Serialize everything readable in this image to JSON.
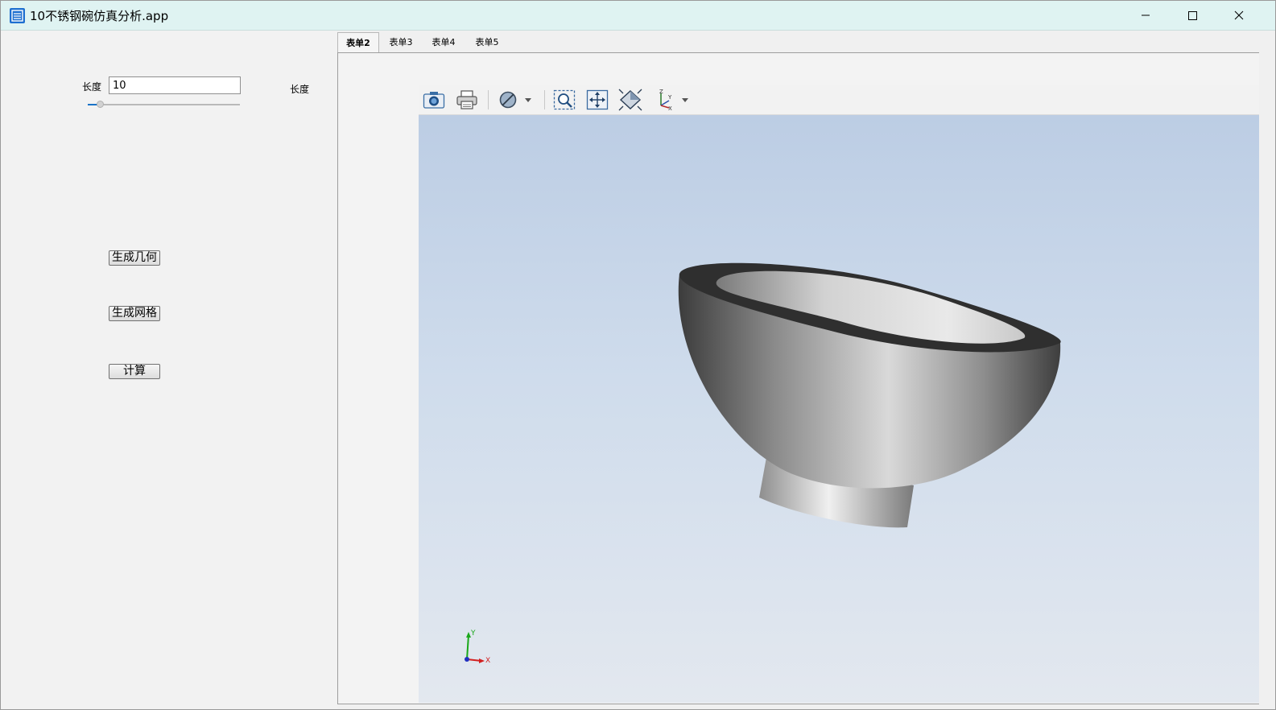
{
  "window": {
    "title": "10不锈钢碗仿真分析.app",
    "controls": {
      "minimize": "minimize-icon",
      "maximize": "maximize-icon",
      "close": "close-icon"
    }
  },
  "left_panel": {
    "length_label": "长度",
    "length_value": "10",
    "length_label_right": "长度",
    "slider_value_fraction": 0.08,
    "buttons": {
      "generate_geometry": "生成几何",
      "generate_mesh": "生成网格",
      "compute": "计算"
    }
  },
  "tabs": [
    {
      "label": "表单2",
      "active": true
    },
    {
      "label": "表单3",
      "active": false
    },
    {
      "label": "表单4",
      "active": false
    },
    {
      "label": "表单5",
      "active": false
    }
  ],
  "toolbar": {
    "icons": [
      "camera-icon",
      "print-icon",
      "transparency-icon",
      "zoom-box-icon",
      "zoom-extents-icon",
      "scene-light-icon",
      "view-axis-icon"
    ]
  },
  "axis_triad": {
    "x": "X",
    "y": "Y"
  },
  "colors": {
    "titlebar": "#dff3f2",
    "accent": "#1a73c8",
    "viewport_top": "#bccde4",
    "viewport_bottom": "#e3e8ef"
  }
}
